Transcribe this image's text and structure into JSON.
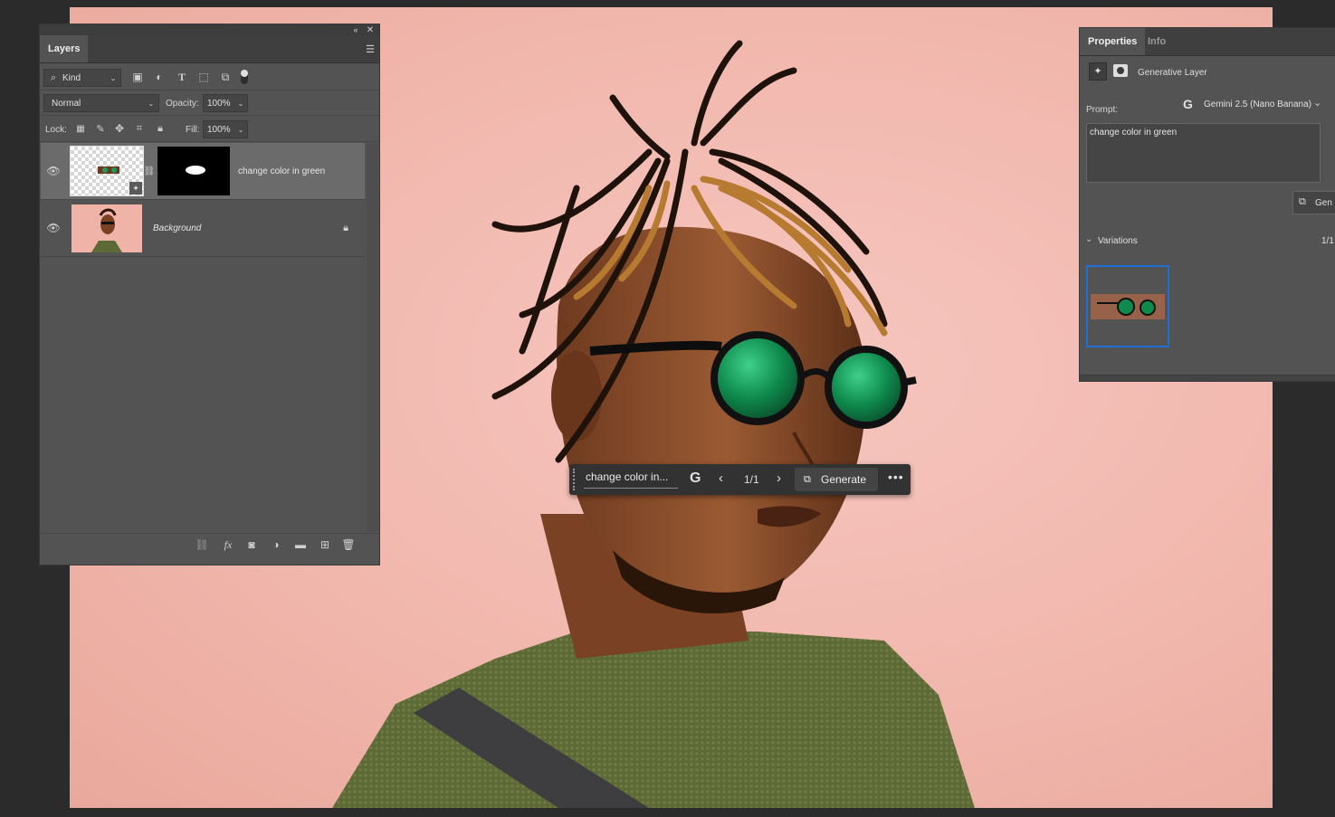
{
  "layers_panel": {
    "tab": "Layers",
    "filter_kind": "Kind",
    "blend_mode": "Normal",
    "opacity_label": "Opacity:",
    "opacity_value": "100%",
    "lock_label": "Lock:",
    "fill_label": "Fill:",
    "fill_value": "100%",
    "layers": [
      {
        "name": "change color in green",
        "selected": true,
        "visible": true
      },
      {
        "name": "Background",
        "locked": true,
        "visible": true
      }
    ],
    "footer_icons": [
      "link-icon",
      "fx-icon",
      "mask-icon",
      "adjustment-icon",
      "folder-icon",
      "new-layer-icon",
      "trash-icon"
    ]
  },
  "properties_panel": {
    "tabs": [
      "Properties",
      "Info"
    ],
    "layer_type": "Generative Layer",
    "prompt_label": "Prompt:",
    "model": "Gemini 2.5 (Nano Banana)",
    "prompt_text": "change color in green",
    "generate_button_partial": "Gen",
    "variations_label": "Variations",
    "variations_count": "1/1"
  },
  "taskbar": {
    "prompt_text": "change color in...",
    "page": "1/1",
    "generate_label": "Generate"
  },
  "colors": {
    "canvas_bg": "#f1b7ad",
    "panel_bg": "#535353",
    "selection_blue": "#1f6fd6",
    "lens_green": "#0e8a4d"
  }
}
